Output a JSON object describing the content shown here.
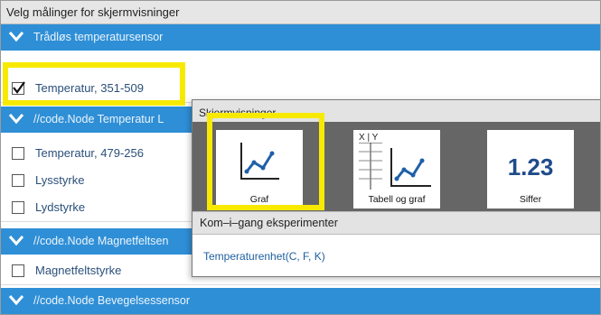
{
  "window": {
    "title": "Velg målinger for skjermvisninger"
  },
  "groups": [
    {
      "label": "Trådløs temperatursensor"
    },
    {
      "label": "//code.Node Temperatur L"
    },
    {
      "label": "//code.Node Magnetfeltsen"
    },
    {
      "label": "//code.Node Bevegelsessensor"
    }
  ],
  "measurements": [
    {
      "label": "Temperatur, 351-509",
      "checked": true
    },
    {
      "label": "Temperatur, 479-256",
      "checked": false
    },
    {
      "label": "Lysstyrke",
      "checked": false
    },
    {
      "label": "Lydstyrke",
      "checked": false
    },
    {
      "label": "Magnetfeltstyrke",
      "checked": false
    }
  ],
  "popup": {
    "title": "Skjermvisninger",
    "tiles": [
      {
        "label": "Graf",
        "icon": "graph-icon"
      },
      {
        "label": "Tabell og graf",
        "icon": "table-graph-icon",
        "header": "X | Y"
      },
      {
        "label": "Siffer",
        "icon": "digits-icon",
        "value": "1.23"
      }
    ],
    "section": "Kom–i–gang eksperimenter",
    "experiment": "Temperaturenhet(C, F, K)"
  },
  "colors": {
    "group_bar": "#2f8fd6",
    "highlight": "#f7ea00",
    "link_text": "#2a4f7a"
  }
}
